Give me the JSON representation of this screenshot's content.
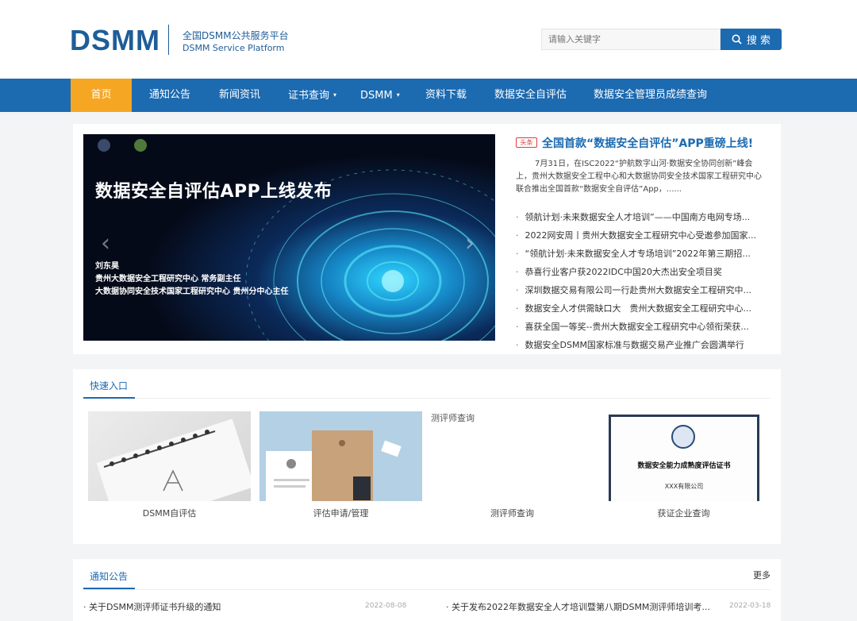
{
  "header": {
    "logo": "DSMM",
    "platform_cn": "全国DSMM公共服务平台",
    "platform_en": "DSMM Service Platform",
    "search_placeholder": "请输入关键字",
    "search_label": "搜 索"
  },
  "nav": {
    "items": [
      {
        "label": "首页",
        "active": true
      },
      {
        "label": "通知公告"
      },
      {
        "label": "新闻资讯"
      },
      {
        "label": "证书查询",
        "dropdown": true
      },
      {
        "label": "DSMM",
        "dropdown": true
      },
      {
        "label": "资料下载"
      },
      {
        "label": "数据安全自评估"
      },
      {
        "label": "数据安全管理员成绩查询"
      }
    ]
  },
  "banner": {
    "title": "数据安全自评估APP上线发布",
    "person_name": "刘东昊",
    "person_role1": "贵州大数据安全工程研究中心  常务副主任",
    "person_role2": "大数据协同安全技术国家工程研究中心  贵州分中心主任"
  },
  "featured": {
    "tag": "头条",
    "title": "全国首款“数据安全自评估”APP重磅上线!",
    "summary": "7月31日，在ISC2022“护航数字山河·数据安全协同创新”峰会上，贵州大数据安全工程中心和大数据协同安全技术国家工程研究中心联合推出全国首款“数据安全自评估”App，......"
  },
  "news": [
    "领航计划·未来数据安全人才培训”——中国南方电网专场...",
    "2022网安周丨贵州大数据安全工程研究中心受邀参加国家...",
    "“领航计划·未来数据安全人才专场培训”2022年第三期招...",
    "恭喜行业客户获2022IDC中国20大杰出安全项目奖",
    "深圳数据交易有限公司一行赴贵州大数据安全工程研究中...",
    "数据安全人才供需缺口大　贵州大数据安全工程研究中心...",
    "喜获全国一等奖--贵州大数据安全工程研究中心领衔荣获...",
    "数据安全DSMM国家标准与数据交易产业推广会圆满举行"
  ],
  "quick": {
    "title": "快速入口",
    "cards": [
      {
        "label": "DSMM自评估"
      },
      {
        "label": "评估申请/管理"
      },
      {
        "label": "测评师查询",
        "alt": "测评师查询"
      },
      {
        "label": "获证企业查询",
        "cert_title": "数据安全能力成熟度评估证书",
        "cert_company": "XXX有限公司"
      }
    ]
  },
  "notice": {
    "title": "通知公告",
    "more": "更多",
    "items": [
      {
        "title": "关于DSMM测评师证书升级的通知",
        "date": "2022-08-08"
      },
      {
        "title": "关于发布2022年数据安全人才培训暨第八期DSMM测评师培训考...",
        "date": "2022-03-18"
      }
    ]
  },
  "colors": {
    "primary": "#1c6ab0",
    "active": "#f5a623",
    "logo": "#1f5d99"
  }
}
